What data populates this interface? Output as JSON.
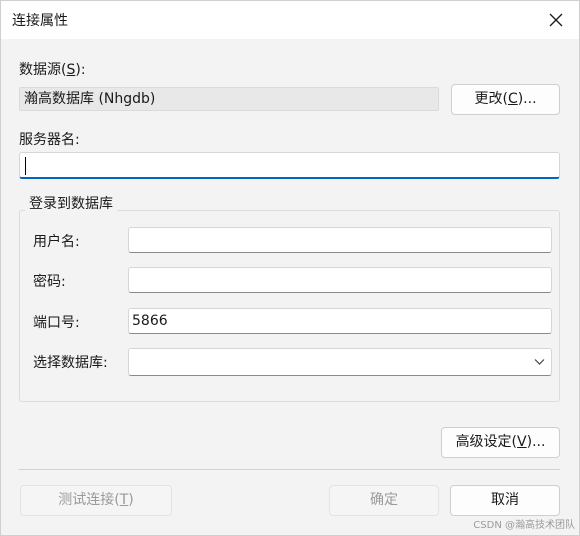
{
  "window": {
    "title": "连接属性",
    "close_icon": "close-icon"
  },
  "data_source": {
    "label": "数据源(",
    "accel": "S",
    "label_end": "):",
    "value": "瀚高数据库 (Nhgdb)",
    "change_button": {
      "label": "更改(",
      "accel": "C",
      "label_end": ")..."
    }
  },
  "server": {
    "label": "服务器名:",
    "value": ""
  },
  "login_group": {
    "title": "登录到数据库",
    "username": {
      "label": "用户名:",
      "value": ""
    },
    "password": {
      "label": "密码:",
      "value": ""
    },
    "port": {
      "label": "端口号:",
      "value": "5866"
    },
    "database": {
      "label": "选择数据库:",
      "selected": "",
      "chevron_icon": "chevron-down-icon"
    }
  },
  "advanced_button": {
    "label": "高级设定(",
    "accel": "V",
    "label_end": ")..."
  },
  "footer": {
    "test_button": {
      "label": "测试连接(",
      "accel": "T",
      "label_end": ")"
    },
    "ok_button": {
      "label": "确定"
    },
    "cancel_button": {
      "label": "取消"
    }
  },
  "watermark": "CSDN @瀚高技术团队",
  "colors": {
    "accent": "#0067c0",
    "dialog_bg": "#f3f3f3",
    "disabled_text": "#9a9a9a"
  }
}
